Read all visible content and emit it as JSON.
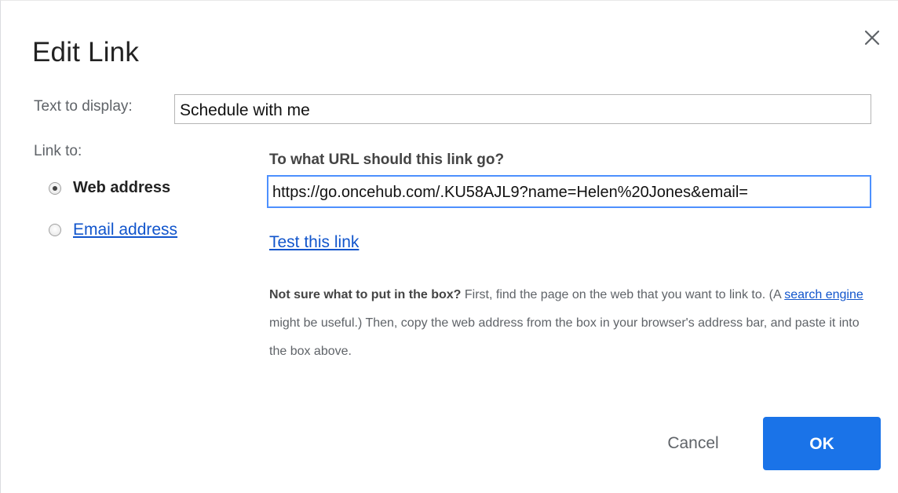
{
  "dialog": {
    "title": "Edit Link",
    "close_icon": "close-icon"
  },
  "display": {
    "label": "Text to display:",
    "value": "Schedule with me"
  },
  "link_to": {
    "label": "Link to:",
    "options": [
      {
        "label": "Web address",
        "selected": true
      },
      {
        "label": "Email address",
        "selected": false
      }
    ]
  },
  "url": {
    "question": "To what URL should this link go?",
    "value": "https://go.oncehub.com/.KU58AJL9?name=Helen%20Jones&email=",
    "test_link": "Test this link"
  },
  "help": {
    "bold": "Not sure what to put in the box?",
    "part1": " First, find the page on the web that you want to link to. (A ",
    "link": "search engine",
    "part2": " might be useful.) Then, copy the web address from the box in your browser's address bar, and paste it into the box above."
  },
  "buttons": {
    "cancel": "Cancel",
    "ok": "OK"
  },
  "colors": {
    "primary": "#1a73e8",
    "link": "#1155cc",
    "focus_border": "#4d90fe"
  }
}
